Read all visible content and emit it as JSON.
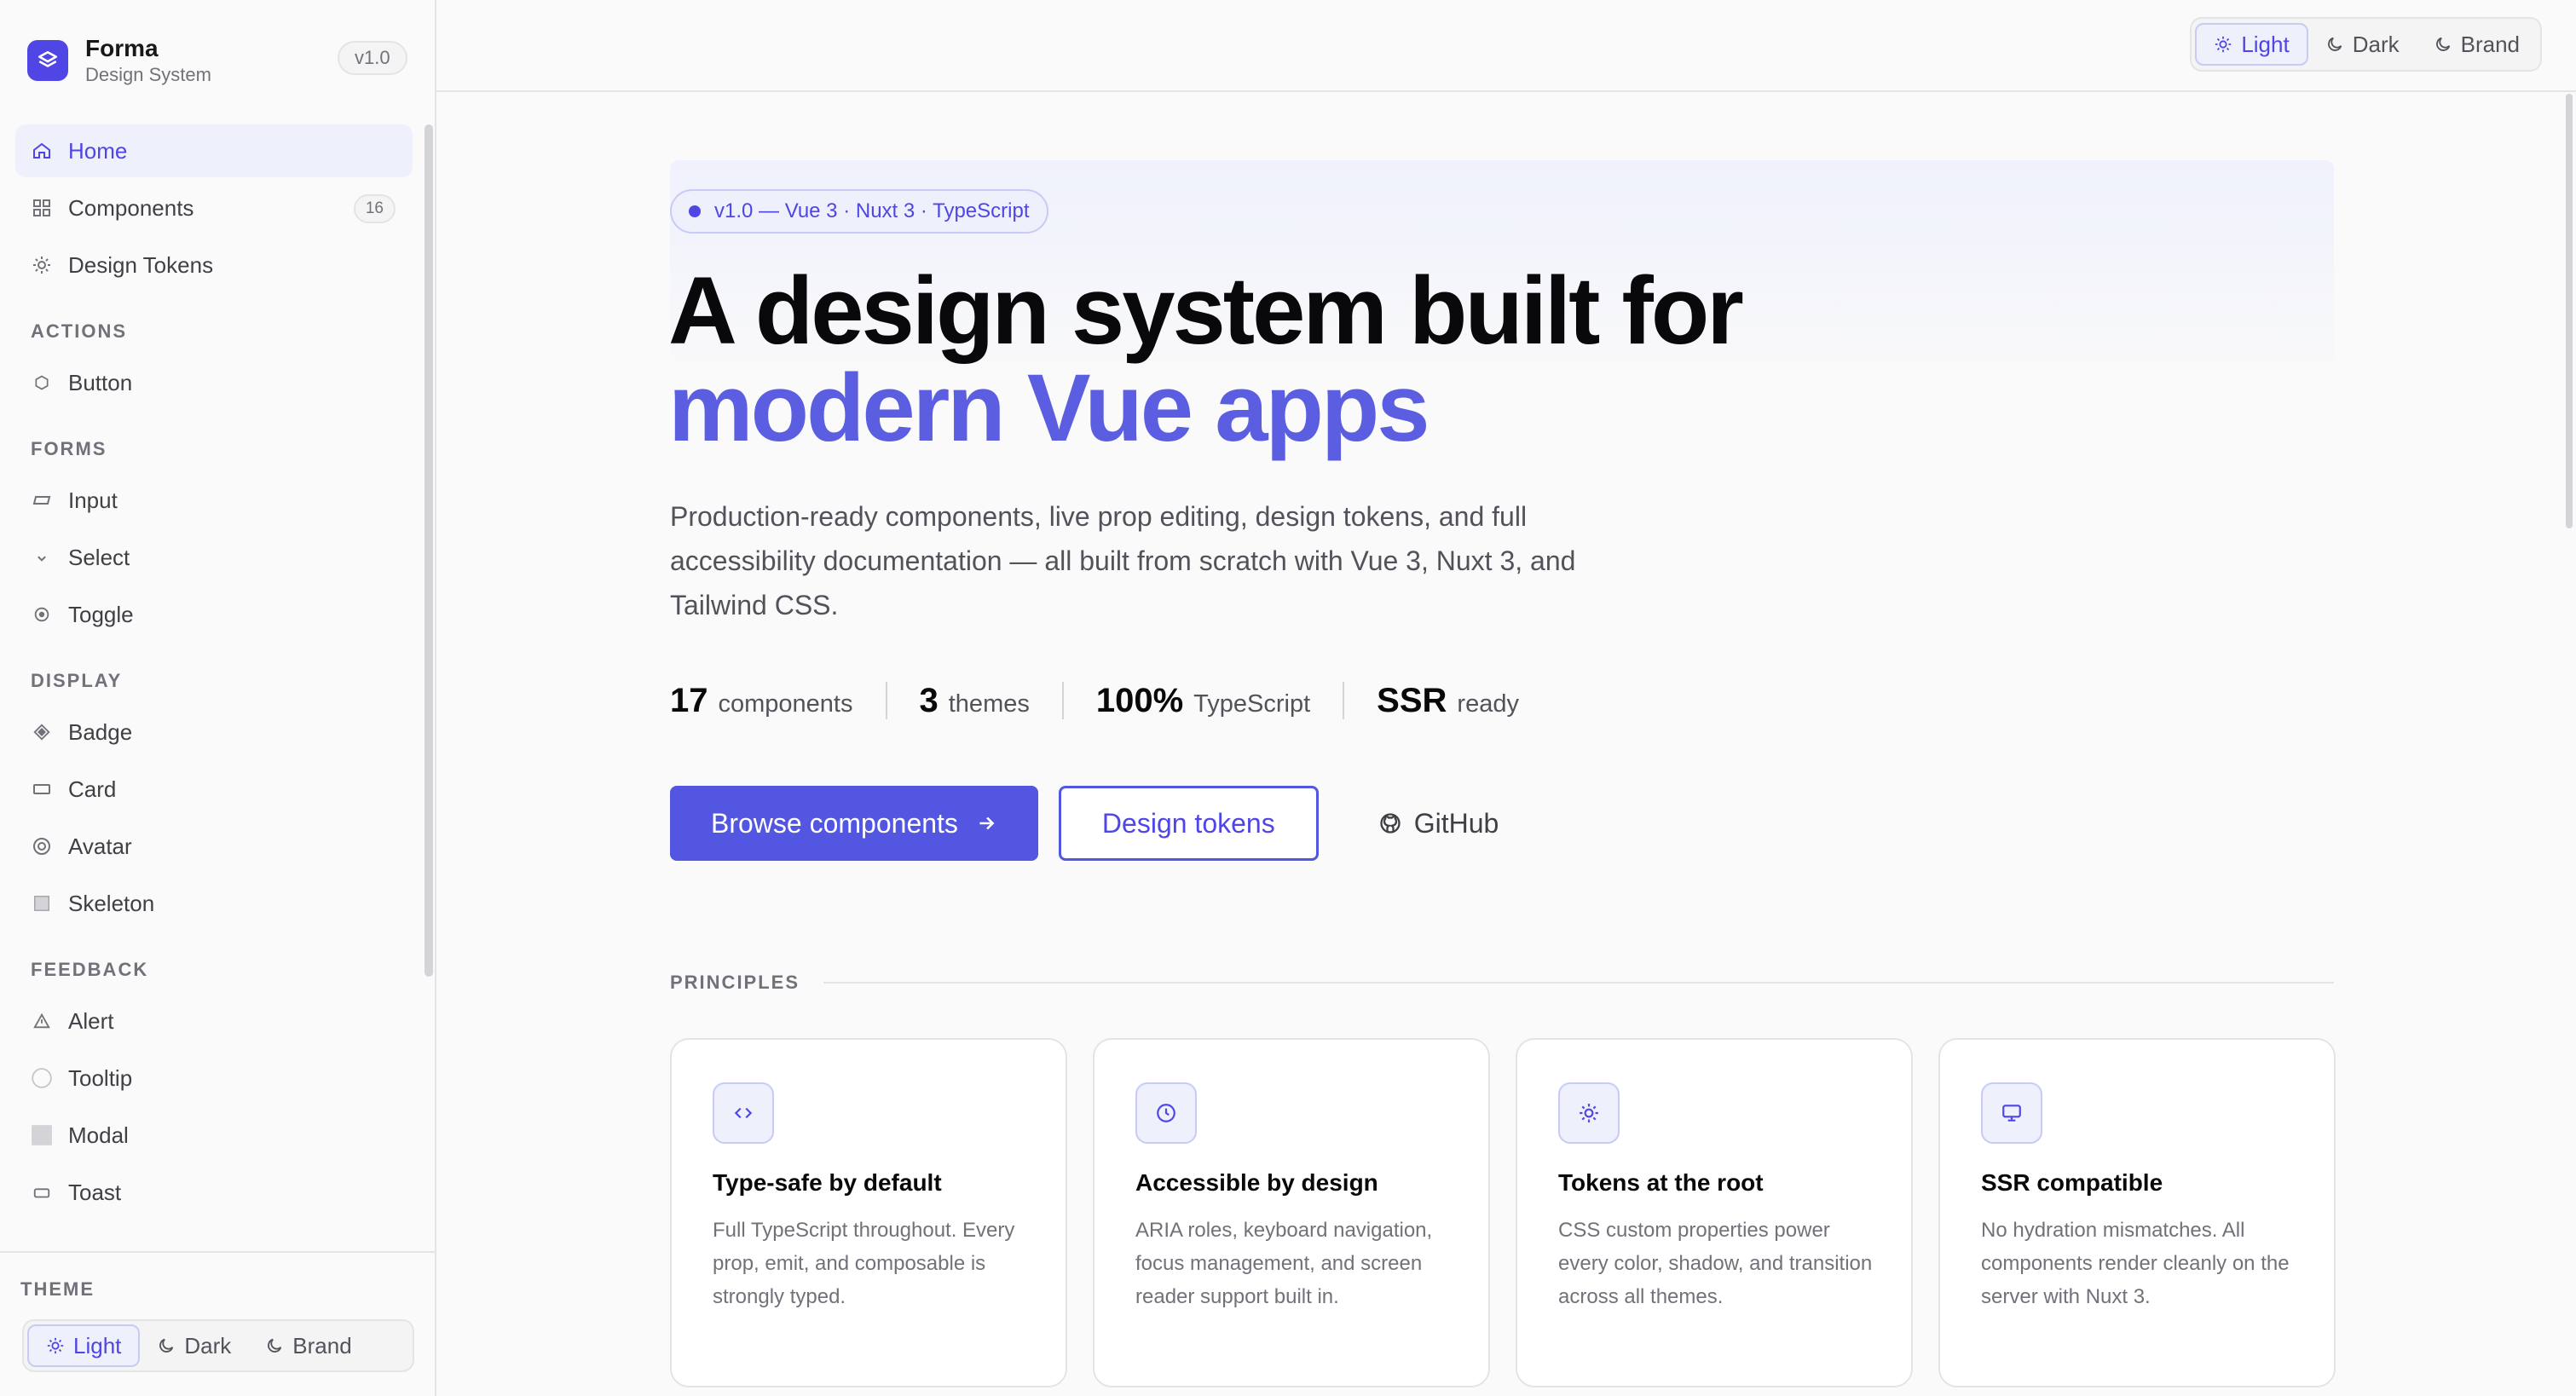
{
  "brand": {
    "name": "Forma",
    "subtitle": "Design System",
    "version": "v1.0"
  },
  "sidebar": {
    "items": [
      {
        "label": "Home",
        "icon": "home-icon",
        "active": true
      },
      {
        "label": "Components",
        "icon": "grid-icon",
        "count": "16"
      },
      {
        "label": "Design Tokens",
        "icon": "sun-icon"
      }
    ],
    "sections": [
      {
        "title": "ACTIONS",
        "items": [
          {
            "label": "Button",
            "icon": "hexagon-icon"
          }
        ]
      },
      {
        "title": "FORMS",
        "items": [
          {
            "label": "Input",
            "icon": "input-icon"
          },
          {
            "label": "Select",
            "icon": "chevron-down-icon"
          },
          {
            "label": "Toggle",
            "icon": "toggle-icon"
          }
        ]
      },
      {
        "title": "DISPLAY",
        "items": [
          {
            "label": "Badge",
            "icon": "diamond-icon"
          },
          {
            "label": "Card",
            "icon": "card-icon"
          },
          {
            "label": "Avatar",
            "icon": "avatar-icon"
          },
          {
            "label": "Skeleton",
            "icon": "skeleton-icon"
          }
        ]
      },
      {
        "title": "FEEDBACK",
        "items": [
          {
            "label": "Alert",
            "icon": "warning-icon"
          },
          {
            "label": "Tooltip",
            "icon": "tooltip-icon"
          },
          {
            "label": "Modal",
            "icon": "modal-icon"
          },
          {
            "label": "Toast",
            "icon": "toast-icon"
          }
        ]
      }
    ],
    "theme_label": "THEME"
  },
  "theme": {
    "options": [
      "Light",
      "Dark",
      "Brand"
    ],
    "selected": "Light"
  },
  "hero": {
    "badge": "v1.0 — Vue 3 · Nuxt 3 · TypeScript",
    "title_line1": "A design system built for",
    "title_line2": "modern Vue apps",
    "description": "Production-ready components, live prop editing, design tokens, and full accessibility documentation — all built from scratch with Vue 3, Nuxt 3, and Tailwind CSS.",
    "stats": [
      {
        "value": "17",
        "label": "components"
      },
      {
        "value": "3",
        "label": "themes"
      },
      {
        "value": "100%",
        "label": "TypeScript"
      },
      {
        "value": "SSR",
        "label": "ready"
      }
    ],
    "cta_primary": "Browse components",
    "cta_secondary": "Design tokens",
    "cta_github": "GitHub"
  },
  "principles": {
    "heading": "PRINCIPLES",
    "cards": [
      {
        "icon": "code-icon",
        "title": "Type-safe by default",
        "text": "Full TypeScript throughout. Every prop, emit, and composable is strongly typed."
      },
      {
        "icon": "clock-icon",
        "title": "Accessible by design",
        "text": "ARIA roles, keyboard navigation, focus management, and screen reader support built in."
      },
      {
        "icon": "sun-icon",
        "title": "Tokens at the root",
        "text": "CSS custom properties power every color, shadow, and transition across all themes."
      },
      {
        "icon": "monitor-icon",
        "title": "SSR compatible",
        "text": "No hydration mismatches. All components render cleanly on the server with Nuxt 3."
      }
    ]
  },
  "colors": {
    "accent": "#5256e0",
    "accent_soft": "#eef0fc",
    "text": "#09090b",
    "muted": "#71717a"
  }
}
